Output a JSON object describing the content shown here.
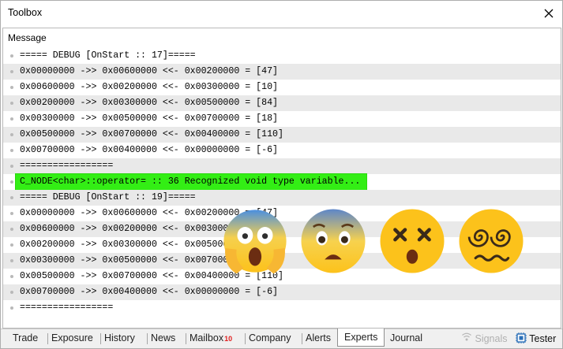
{
  "window": {
    "title": "Toolbox"
  },
  "log": {
    "column_header": "Message",
    "rows": [
      {
        "text": "===== DEBUG [OnStart :: 17]=====",
        "highlight": false
      },
      {
        "text": "0x00000000 ->> 0x00600000 <<- 0x00200000 = [47]",
        "highlight": false
      },
      {
        "text": "0x00600000 ->> 0x00200000 <<- 0x00300000 = [10]",
        "highlight": false
      },
      {
        "text": "0x00200000 ->> 0x00300000 <<- 0x00500000 = [84]",
        "highlight": false
      },
      {
        "text": "0x00300000 ->> 0x00500000 <<- 0x00700000 = [18]",
        "highlight": false
      },
      {
        "text": "0x00500000 ->> 0x00700000 <<- 0x00400000 = [110]",
        "highlight": false
      },
      {
        "text": "0x00700000 ->> 0x00400000 <<- 0x00000000 = [-6]",
        "highlight": false
      },
      {
        "text": "=================",
        "highlight": false
      },
      {
        "text": "C_NODE<char>::operator= :: 36 Recognized void type variable...",
        "highlight": true
      },
      {
        "text": "===== DEBUG [OnStart :: 19]=====",
        "highlight": false
      },
      {
        "text": "0x00000000 ->> 0x00600000 <<- 0x00200000 = [47]",
        "highlight": false
      },
      {
        "text": "0x00600000 ->> 0x00200000 <<- 0x00300000 = [10]",
        "highlight": false
      },
      {
        "text": "0x00200000 ->> 0x00300000 <<- 0x00500000 = [84]",
        "highlight": false
      },
      {
        "text": "0x00300000 ->> 0x00500000 <<- 0x00700000 = [18]",
        "highlight": false
      },
      {
        "text": "0x00500000 ->> 0x00700000 <<- 0x00400000 = [110]",
        "highlight": false
      },
      {
        "text": "0x00700000 ->> 0x00400000 <<- 0x00000000 = [-6]",
        "highlight": false
      },
      {
        "text": "=================",
        "highlight": false
      }
    ]
  },
  "overlay_emojis": [
    "screaming-face-icon",
    "anguished-face-icon",
    "dizzy-face-icon",
    "woozy-face-icon"
  ],
  "tabs": {
    "items": [
      {
        "label": "Trade"
      },
      {
        "label": "Exposure"
      },
      {
        "label": "History"
      },
      {
        "label": "News"
      },
      {
        "label": "Mailbox",
        "badge": "10"
      },
      {
        "label": "Company"
      },
      {
        "label": "Alerts"
      },
      {
        "label": "Experts",
        "active": true
      },
      {
        "label": "Journal"
      }
    ],
    "signals_label": "Signals",
    "tester_label": "Tester"
  },
  "colors": {
    "highlight": "#33ee15",
    "row_alt": "#e9e9e9",
    "emoji_yellow": "#fcc21b",
    "emoji_blue": "#4a8fe0"
  }
}
